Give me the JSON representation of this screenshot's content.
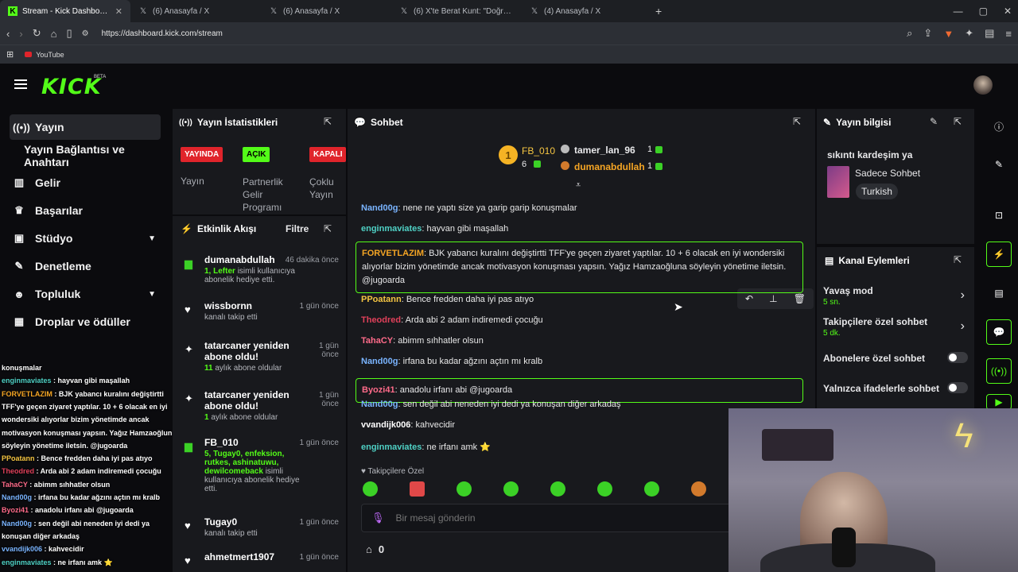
{
  "browser": {
    "tabs": [
      {
        "title": "Stream - Kick Dashboard",
        "icon": "kick-icon"
      },
      {
        "title": "(6) Anasayfa / X",
        "icon": "x-icon"
      },
      {
        "title": "(6) Anasayfa / X",
        "icon": "x-icon"
      },
      {
        "title": "(6) X'te Berat Kunt: \"Doğru bir hamle",
        "icon": "x-icon"
      },
      {
        "title": "(4) Anasayfa / X",
        "icon": "x-icon"
      }
    ],
    "url": "https://dashboard.kick.com/stream",
    "bookmark": "YouTube"
  },
  "brand": {
    "logo": "KICK",
    "beta": "BETA"
  },
  "sidebar": {
    "items": [
      {
        "label": "Yayın",
        "icon": "broadcast-icon"
      },
      {
        "label": "Yayın Bağlantısı ve Anahtarı"
      },
      {
        "label": "Gelir",
        "icon": "chart-icon"
      },
      {
        "label": "Başarılar",
        "icon": "trophy-icon"
      },
      {
        "label": "Stüdyo",
        "icon": "studio-icon"
      },
      {
        "label": "Denetleme",
        "icon": "wrench-icon"
      },
      {
        "label": "Topluluk",
        "icon": "users-icon"
      },
      {
        "label": "Droplar ve ödüller",
        "icon": "drops-icon"
      }
    ]
  },
  "stats": {
    "title": "Yayın İstatistikleri",
    "badges": [
      {
        "label": "YAYINDA",
        "caption": "Yayın",
        "color": "#e0242b"
      },
      {
        "label": "AÇIK",
        "caption": "Partnerlik Gelir Programı",
        "color": "#53fc18"
      },
      {
        "label": "KAPALI",
        "caption": "Çoklu Yayın",
        "color": "#e0242b"
      }
    ]
  },
  "feed": {
    "title": "Etkinlik Akışı",
    "filter": "Filtre",
    "items": [
      {
        "name": "dumanabdullah",
        "time": "46 dakika önce",
        "hl": "1, Lefter",
        "sub": "isimli kullanıcıya abonelik hediye etti."
      },
      {
        "name": "wissbornn",
        "time": "1 gün önce",
        "sub": "kanalı takip etti"
      },
      {
        "name": "tatarcaner yeniden abone oldu!",
        "time": "1 gün önce",
        "hl": "11",
        "sub": "aylık abone oldular"
      },
      {
        "name": "tatarcaner yeniden abone oldu!",
        "time": "1 gün önce",
        "hl": "1",
        "sub": "aylık abone oldular"
      },
      {
        "name": "FB_010",
        "time": "1 gün önce",
        "hl": "5, Tugay0, enfeksion, rutkes, ashinatuwu, dewilcomeback",
        "sub": "isimli kullanıcıya abonelik hediye etti."
      },
      {
        "name": "Tugay0",
        "time": "1 gün önce",
        "sub": "kanalı takip etti"
      },
      {
        "name": "ahmetmert1907",
        "time": "1 gün önce"
      }
    ]
  },
  "chat": {
    "title": "Sohbet",
    "leaders": [
      {
        "rank": "1",
        "name": "FB_010",
        "count": "6"
      },
      {
        "name": "tamer_lan_96",
        "count": "1"
      },
      {
        "name": "dumanabdullah",
        "count": "1"
      }
    ],
    "messages": [
      {
        "user": "Nand00g",
        "text": ": nene ne yaptı size ya garip garip konuşmalar",
        "color": "#7ab4ff"
      },
      {
        "user": "enginmaviates",
        "text": ": hayvan gibi maşallah",
        "color": "#4fd1c5"
      },
      {
        "user": "FORVETLAZIM",
        "text": ": BJK yabancı kuralını değiştirtti TFF'ye geçen ziyaret yaptılar. 10 + 6 olacak en iyi wondersiki alıyorlar bizim yönetimde ancak motivasyon konuşması yapsın. Yağız Hamzaoğluna söyleyin yönetime iletsin. @jugoarda",
        "color": "#f5a524",
        "highlight": true
      },
      {
        "user": "PPoatann",
        "text": ": Bence fredden daha iyi pas atıyo",
        "color": "#f5c542"
      },
      {
        "user": "Theodred",
        "text": ": Arda abi 2 adam indiremedi çocuğu",
        "color": "#e0405a"
      },
      {
        "user": "TahaCY",
        "text": ": abimm sıhhatler olsun",
        "color": "#ff6b8a"
      },
      {
        "user": "Nand00g",
        "text": ": irfana bu kadar ağzını açtın mı kralb",
        "color": "#7ab4ff"
      },
      {
        "user": "Byozi41",
        "text": ": anadolu irfanı abi @jugoarda",
        "color": "#ff6b8a",
        "highlight": true
      },
      {
        "user": "Nand00g",
        "text": ": sen değil abi neneden iyi dedi ya konuşan diğer arkadaş",
        "color": "#7ab4ff"
      },
      {
        "user": "vvandijk006",
        "text": ": kahvecidir",
        "color": "#ffffff"
      },
      {
        "user": "enginmaviates",
        "text": ": ne irfanı amk ⭐",
        "color": "#4fd1c5"
      }
    ],
    "followers_only": "Takipçilere Özel",
    "input_placeholder": "Bir mesaj gönderin",
    "points": "0"
  },
  "stream_info": {
    "title": "Yayın bilgisi",
    "stream_title": "sıkıntı kardeşim ya",
    "category": "Sadece Sohbet",
    "language": "Turkish"
  },
  "channel_actions": {
    "title": "Kanal Eylemleri",
    "items": [
      {
        "label": "Yavaş mod",
        "value": "5 sn."
      },
      {
        "label": "Takipçilere özel sohbet",
        "value": "5 dk."
      },
      {
        "label": "Abonelere özel sohbet"
      },
      {
        "label": "Yalnızca ifadelerle sohbet"
      }
    ]
  },
  "overlay_chat": [
    {
      "user": "",
      "text": "konuşmalar"
    },
    {
      "user": "enginmaviates",
      "text": " : hayvan gibi maşallah",
      "color": "#4fd1c5"
    },
    {
      "user": "FORVETLAZIM",
      "text": " : BJK yabancı kuralını değiştirtti",
      "color": "#f5a524"
    },
    {
      "user": "",
      "text": "TFF'ye geçen ziyaret yaptılar. 10 + 6 olacak en iyi"
    },
    {
      "user": "",
      "text": "wondersiki alıyorlar bizim yönetimde ancak"
    },
    {
      "user": "",
      "text": "motivasyon konuşması yapsın. Yağız Hamzaoğluna"
    },
    {
      "user": "",
      "text": "söyleyin yönetime iletsin. @jugoarda"
    },
    {
      "user": "PPoatann",
      "text": " : Bence fredden daha iyi pas atıyo",
      "color": "#f5c542"
    },
    {
      "user": "Theodred",
      "text": " : Arda abi 2 adam indiremedi çocuğu",
      "color": "#e0405a"
    },
    {
      "user": "TahaCY",
      "text": " : abimm sıhhatler olsun",
      "color": "#ff6b8a"
    },
    {
      "user": "Nand00g",
      "text": " : irfana bu kadar ağzını açtın mı kralb",
      "color": "#7ab4ff"
    },
    {
      "user": "Byozi41",
      "text": " : anadolu irfanı abi @jugoarda",
      "color": "#ff6b8a"
    },
    {
      "user": "Nand00g",
      "text": " : sen değil abi neneden iyi dedi ya",
      "color": "#7ab4ff"
    },
    {
      "user": "",
      "text": "konuşan diğer arkadaş"
    },
    {
      "user": "vvandijk006",
      "text": " : kahvecidir",
      "color": "#7ab4ff"
    },
    {
      "user": "enginmaviates",
      "text": " : ne irfanı amk ⭐",
      "color": "#4fd1c5"
    }
  ],
  "colors": {
    "accent": "#53fc18",
    "live": "#e0242b",
    "panel": "#18191d"
  }
}
